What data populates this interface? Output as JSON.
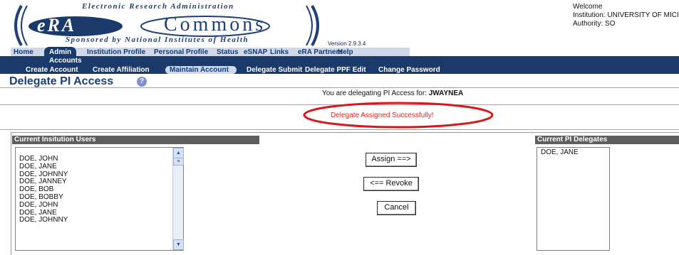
{
  "header": {
    "tagline_top": "Electronic Research Administration",
    "logo_left": "eRA",
    "logo_right": "Commons",
    "tagline_bottom": "Sponsored by National Institutes of Health",
    "version": "Version 2.9.3.4",
    "welcome": "Welcome",
    "institution": "Institution: UNIVERSITY OF MICI",
    "authority": "Authority:  SO"
  },
  "topnav": [
    "Home",
    "Admin",
    "Institution Profile",
    "Personal Profile",
    "Status",
    "eSNAP",
    "Links",
    "eRA Partners",
    "Help"
  ],
  "accounts_label": "Accounts",
  "subnav": [
    "Create Account",
    "Create Affiliation",
    "Maintain Account",
    "Delegate Submit",
    "Delegate PPF Edit",
    "Change Password"
  ],
  "page": {
    "title": "Delegate PI Access",
    "help_glyph": "?",
    "delegating_prefix": "You are delegating PI Access for:",
    "delegating_user": "JWAYNEA",
    "success_message": "Delegate Assigned Successfully!"
  },
  "left_panel": {
    "header": "Current Insitution Users",
    "users": [
      "DOE, JOHN",
      "DOE, JANE",
      "DOE, JOHNNY",
      "DOE, JANNEY",
      "DOE, BOB",
      "DOE, BOBBY",
      "DOE, JOHN",
      "DOE, JANE",
      "DOE, JOHNNY"
    ]
  },
  "buttons": {
    "assign": "Assign ==>",
    "revoke": "<== Revoke",
    "cancel": "Cancel"
  },
  "right_panel": {
    "header": "Current PI Delegates",
    "delegates": [
      "DOE, JANE"
    ]
  },
  "colors": {
    "navy": "#1a3a6b",
    "success_red": "#e0261c",
    "annotation_red": "#d9161a"
  }
}
